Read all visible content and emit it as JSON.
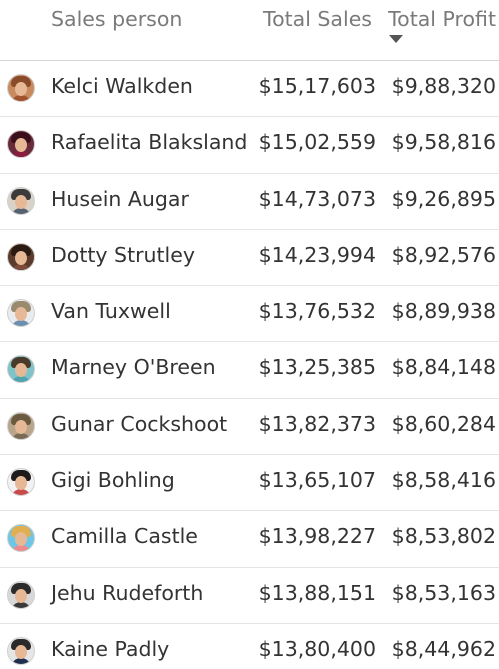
{
  "header": {
    "sales_person": "Sales person",
    "total_sales": "Total Sales",
    "total_profit": "Total Profit"
  },
  "rows": [
    {
      "name": "Kelci Walkden",
      "sales": "$15,17,603",
      "profit": "$9,88,320",
      "avatar_bg": "#c98b5e",
      "avatar_hair": "#8a4b2a",
      "avatar_body": "#a0522d"
    },
    {
      "name": "Rafaelita Blaksland",
      "sales": "$15,02,559",
      "profit": "$9,58,816",
      "avatar_bg": "#6b2a3a",
      "avatar_hair": "#3a0f1c",
      "avatar_body": "#8b1e3f"
    },
    {
      "name": "Husein Augar",
      "sales": "$14,73,073",
      "profit": "$9,26,895",
      "avatar_bg": "#d9d2c8",
      "avatar_hair": "#3b3b3b",
      "avatar_body": "#556070"
    },
    {
      "name": "Dotty Strutley",
      "sales": "$14,23,994",
      "profit": "$8,92,576",
      "avatar_bg": "#5a3a2a",
      "avatar_hair": "#2a1a12",
      "avatar_body": "#7a4a3a"
    },
    {
      "name": "Van Tuxwell",
      "sales": "$13,76,532",
      "profit": "$8,89,938",
      "avatar_bg": "#e8ecef",
      "avatar_hair": "#9a8a70",
      "avatar_body": "#6a8fb0"
    },
    {
      "name": "Marney O'Breen",
      "sales": "$13,25,385",
      "profit": "$8,84,148",
      "avatar_bg": "#7ec3c9",
      "avatar_hair": "#4a3a2a",
      "avatar_body": "#4fa4ad"
    },
    {
      "name": "Gunar Cockshoot",
      "sales": "$13,82,373",
      "profit": "$8,60,284",
      "avatar_bg": "#b8a58c",
      "avatar_hair": "#6a5a40",
      "avatar_body": "#7b6b55"
    },
    {
      "name": "Gigi Bohling",
      "sales": "$13,65,107",
      "profit": "$8,58,416",
      "avatar_bg": "#f2f2f2",
      "avatar_hair": "#1f1a1a",
      "avatar_body": "#c94a4a"
    },
    {
      "name": "Camilla Castle",
      "sales": "$13,98,227",
      "profit": "$8,53,802",
      "avatar_bg": "#6ec6e6",
      "avatar_hair": "#e0b050",
      "avatar_body": "#f08a8a"
    },
    {
      "name": "Jehu Rudeforth",
      "sales": "$13,88,151",
      "profit": "$8,53,163",
      "avatar_bg": "#d8d8d8",
      "avatar_hair": "#2b2b2b",
      "avatar_body": "#3a3a3a"
    },
    {
      "name": "Kaine Padly",
      "sales": "$13,80,400",
      "profit": "$8,44,962",
      "avatar_bg": "#e6e6e6",
      "avatar_hair": "#2a2a2a",
      "avatar_body": "#1f2f4f"
    }
  ]
}
